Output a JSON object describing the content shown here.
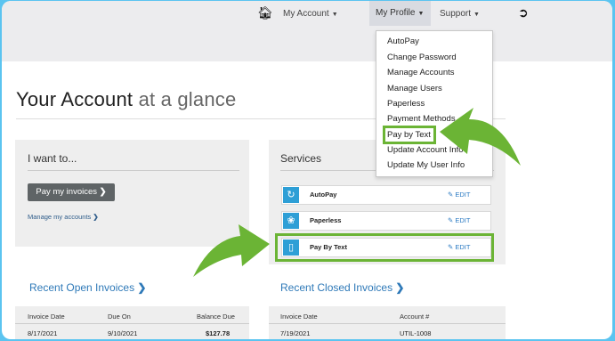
{
  "nav": {
    "home_icon": "home-icon",
    "my_account": "My Account",
    "my_profile": "My Profile",
    "support": "Support",
    "logout_icon": "sign-out-icon"
  },
  "profile_menu": [
    "AutoPay",
    "Change Password",
    "Manage Accounts",
    "Manage Users",
    "Paperless",
    "Payment Methods",
    "Pay by Text",
    "Update Account Info",
    "Update My User Info"
  ],
  "page": {
    "title_main": "Your Account",
    "title_light": "at a glance"
  },
  "i_want": {
    "heading": "I want to...",
    "pay_button": "Pay my invoices",
    "manage_link": "Manage my accounts"
  },
  "services": {
    "heading": "Services",
    "edit_label": "EDIT",
    "items": [
      {
        "label": "AutoPay",
        "icon": "refresh-icon"
      },
      {
        "label": "Paperless",
        "icon": "leaf-icon"
      },
      {
        "label": "Pay By Text",
        "icon": "mobile-phone-icon"
      }
    ]
  },
  "open_invoices": {
    "title": "Recent Open Invoices",
    "headers": [
      "Invoice Date",
      "Due On",
      "Balance Due"
    ],
    "rows": [
      [
        "8/17/2021",
        "9/10/2021",
        "$127.78"
      ]
    ]
  },
  "closed_invoices": {
    "title": "Recent Closed Invoices",
    "headers": [
      "Invoice Date",
      "Account #"
    ],
    "rows": [
      [
        "7/19/2021",
        "UTIL-1008"
      ]
    ]
  },
  "colors": {
    "accent_green": "#6bb435",
    "link_blue": "#2e79b8",
    "service_icon_blue": "#2e9fd6",
    "frame_blue": "#5bc4f0"
  }
}
